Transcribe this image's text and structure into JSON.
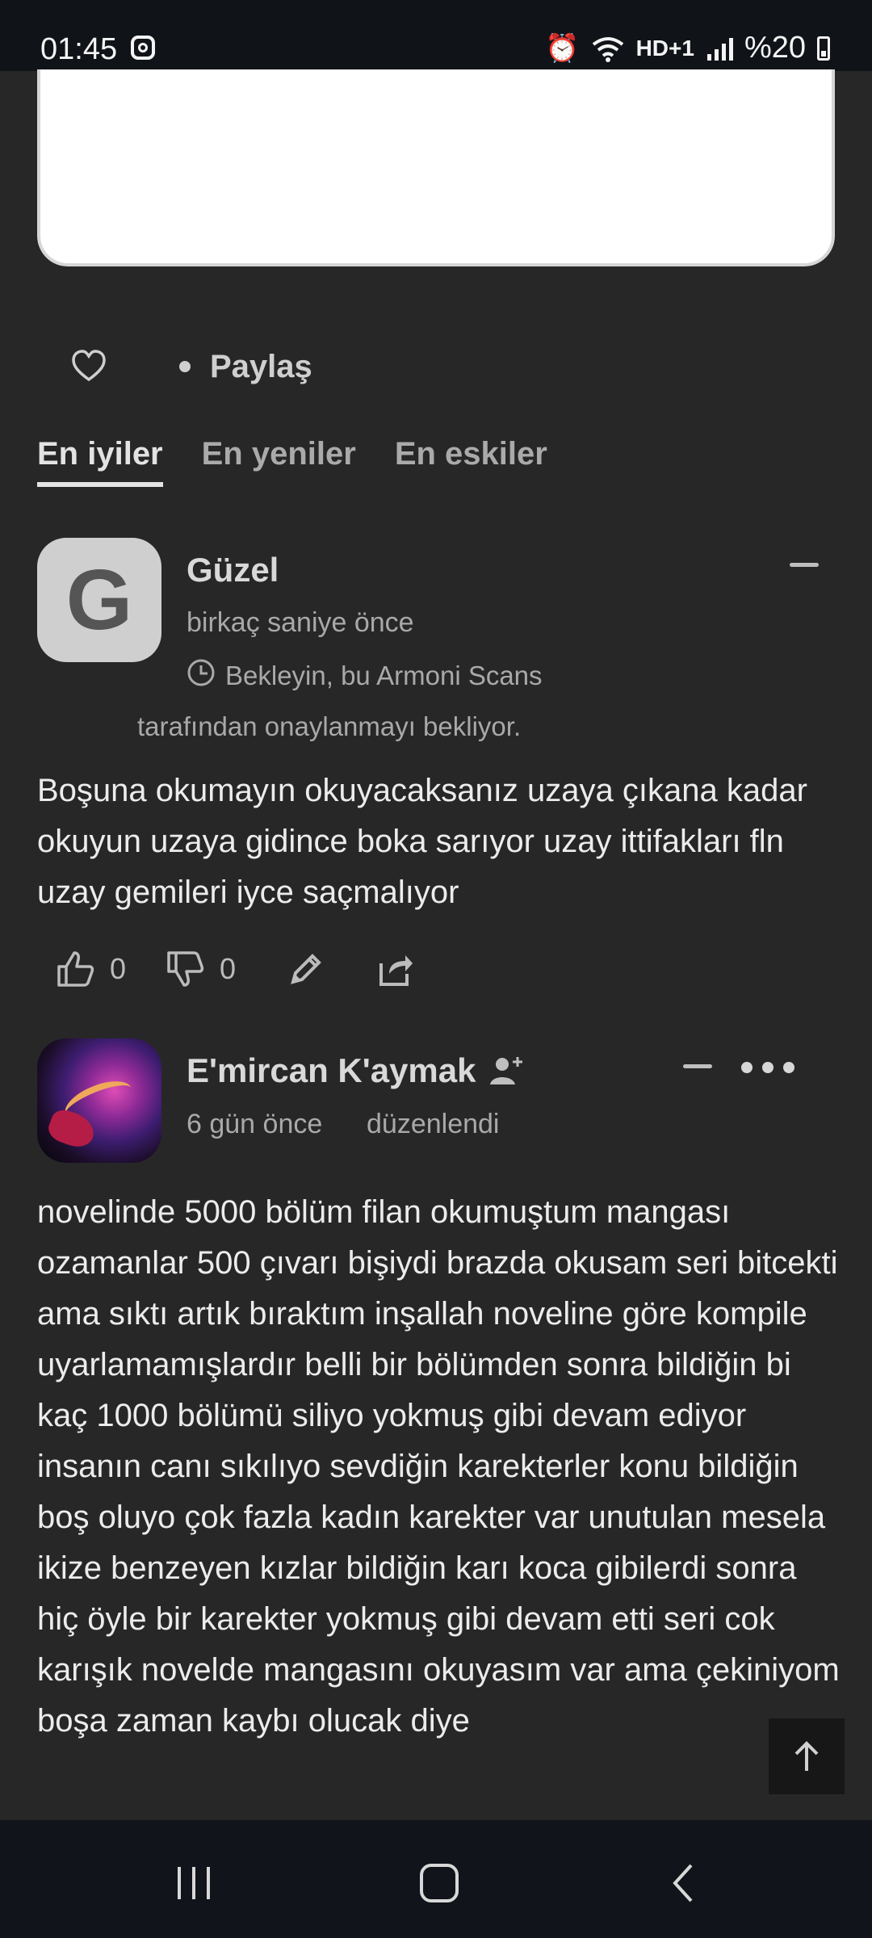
{
  "status": {
    "time": "01:45",
    "battery": "%20",
    "network": "HD+1"
  },
  "actions": {
    "share": "Paylaş"
  },
  "tabs": [
    "En iyiler",
    "En yeniler",
    "En eskiler"
  ],
  "comments": [
    {
      "avatar_letter": "G",
      "author": "Güzel",
      "time": "birkaç saniye önce",
      "pending_line1": "Bekleyin, bu Armoni Scans",
      "pending_line2": "tarafından onaylanmayı bekliyor.",
      "text": "Boşuna okumayın okuyacaksanız uzaya çıkana kadar okuyun uzaya gidince boka sarıyor uzay ittifakları fln uzay gemileri iyce saçmalıyor",
      "likes": "0",
      "dislikes": "0"
    },
    {
      "author": "E'mircan K'aymak",
      "time": "6 gün önce",
      "edited": "düzenlendi",
      "text": "novelinde 5000 bölüm filan okumuştum mangası ozamanlar 500 çıvarı bişiydi brazda okusam seri bitcekti ama sıktı artık bıraktım inşallah noveline göre kompile uyarlamamışlardır belli bir bölümden sonra bildiğin bi kaç 1000 bölümü siliyo yokmuş gibi devam ediyor insanın canı sıkılıyo sevdiğin karekterler konu bildiğin boş oluyo çok fazla kadın karekter var unutulan mesela ikize benzeyen kızlar bildiğin karı koca gibilerdi sonra hiç öyle bir karekter yokmuş gibi devam etti seri cok karışık novelde mangasını okuyasım var ama çekiniyom boşa zaman kaybı olucak diye"
    }
  ]
}
